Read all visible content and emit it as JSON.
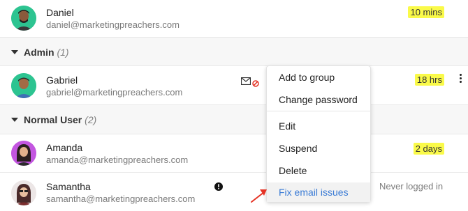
{
  "users_top": {
    "daniel": {
      "name": "Daniel",
      "email": "daniel@marketingpreachers.com",
      "last_seen": "10 mins"
    }
  },
  "groups": {
    "admin": {
      "label": "Admin",
      "count": "(1)"
    },
    "normal": {
      "label": "Normal User",
      "count": "(2)"
    }
  },
  "users": {
    "gabriel": {
      "name": "Gabriel",
      "email": "gabriel@marketingpreachers.com",
      "last_seen": "18 hrs"
    },
    "amanda": {
      "name": "Amanda",
      "email": "amanda@marketingpreachers.com",
      "last_seen": "2 days"
    },
    "samantha": {
      "name": "Samantha",
      "email": "samantha@marketingpreachers.com",
      "last_seen": "Never logged in"
    }
  },
  "context_menu": {
    "add_to_group": "Add to group",
    "change_password": "Change password",
    "edit": "Edit",
    "suspend": "Suspend",
    "delete": "Delete",
    "fix_email": "Fix email issues"
  },
  "colors": {
    "badge": "#fafa49",
    "link": "#3a7bd5",
    "arrow": "#e53325",
    "error": "#e53325"
  },
  "icons": [
    "envelope-icon",
    "blocked-icon",
    "warning-circle-icon",
    "kebab-menu-icon",
    "caret-down-icon",
    "red-arrow-icon"
  ]
}
